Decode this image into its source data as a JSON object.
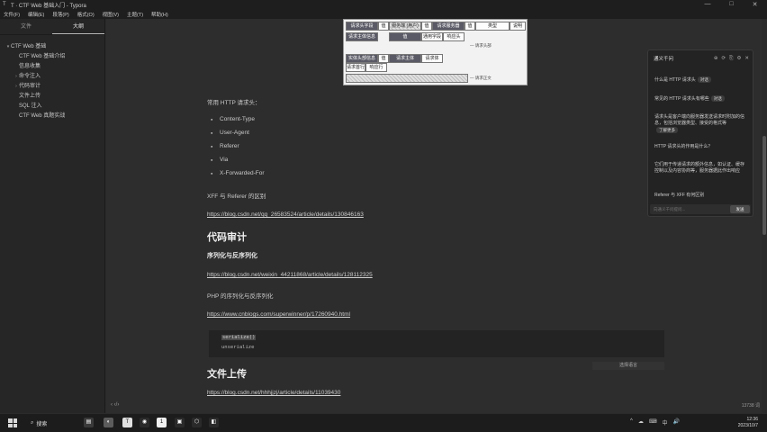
{
  "window": {
    "title": "T · CTF Web 基础入门 - Typora",
    "min_glyph": "—",
    "max_glyph": "□",
    "close_glyph": "✕"
  },
  "menu": [
    "文件(F)",
    "编辑(E)",
    "段落(P)",
    "格式(O)",
    "视图(V)",
    "主题(T)",
    "帮助(H)"
  ],
  "sidebar": {
    "tabs": [
      "文件",
      "大纲"
    ],
    "active_tab": 1,
    "outline": [
      {
        "label": "CTF Web 基础",
        "level": 0,
        "arrow": "▾"
      },
      {
        "label": "CTF Web 基础介绍",
        "level": 1,
        "arrow": ""
      },
      {
        "label": "信息收集",
        "level": 1,
        "arrow": ""
      },
      {
        "label": "命令注入",
        "level": 1,
        "arrow": "›"
      },
      {
        "label": "代码审计",
        "level": 1,
        "arrow": "›"
      },
      {
        "label": "文件上传",
        "level": 1,
        "arrow": ""
      },
      {
        "label": "SQL 注入",
        "level": 1,
        "arrow": ""
      },
      {
        "label": "CTF Web 真题实战",
        "level": 1,
        "arrow": ""
      }
    ]
  },
  "table_image": {
    "row1": [
      "请求头字段",
      "值",
      "服务端 (用户)",
      "值",
      "请求服务器",
      "值",
      "类型",
      "说明"
    ],
    "row2": [
      "请求主体信息",
      "值",
      "通用字段",
      "响应头"
    ],
    "note1": "— 请求头部",
    "row3": [
      "实体头部信息",
      "值",
      "请求主体",
      "请求体"
    ],
    "row4": [
      "请求首行",
      "响应行"
    ],
    "note2": "— 请求正文"
  },
  "doc": {
    "intro": "常用 HTTP 请求头：",
    "bullets": [
      "Content-Type",
      "User-Agent",
      "Referer",
      "Via",
      "X-Forwarded-For"
    ],
    "xff_note": "XFF 与 Referer 的区别",
    "link1": "https://blog.csdn.net/qq_26583524/article/details/130846163",
    "h_code_audit": "代码审计",
    "h_serialize": "序列化与反序列化",
    "link2": "https://blog.csdn.net/weixin_44211868/article/details/128112325",
    "php_note": "PHP 的序列化与反序列化",
    "link3": "https://www.cnblogs.com/superwinner/p/17260940.html",
    "code_line1": "serialize()",
    "code_line2": "unserialize",
    "code_lang": "选择语言",
    "h_upload": "文件上传",
    "link4": "https://blog.csdn.net/hhhjjzj/article/details/11039430"
  },
  "footer": {
    "left": "‹ ‹/›",
    "right": "13738 词"
  },
  "chat": {
    "title": "通义千问",
    "icons": [
      "⊕",
      "⟳",
      "⎘",
      "⚙",
      "✕"
    ],
    "msg1": "什么是 HTTP 请求头",
    "msg1_chip": "对话",
    "msg2": "常见的 HTTP 请求头有哪些",
    "msg2_chip": "对话",
    "msg3": "请求头是客户端向服务器发送请求时附加的信息，包括浏览器类型、接受的格式等",
    "msg3_chip": "了解更多",
    "msg4": "HTTP 请求头的作用是什么？",
    "msg5": "它们用于传递请求的额外信息，如认证、缓存控制以及内容协商等，服务器据此作出响应",
    "msg6": "Referer 与 XFF 有何区别",
    "input_placeholder": "向通义千问提问...",
    "send_label": "发送"
  },
  "taskbar": {
    "search_label": "搜索",
    "tray": [
      "^",
      "☁",
      "⌨",
      "中",
      "🔊"
    ],
    "time": "12:36",
    "date": "2023/10/7"
  },
  "colors": {
    "editor_bg": "#2d2d2d",
    "sidebar_bg": "#262626",
    "taskbar_bg": "#1c1c1c"
  }
}
